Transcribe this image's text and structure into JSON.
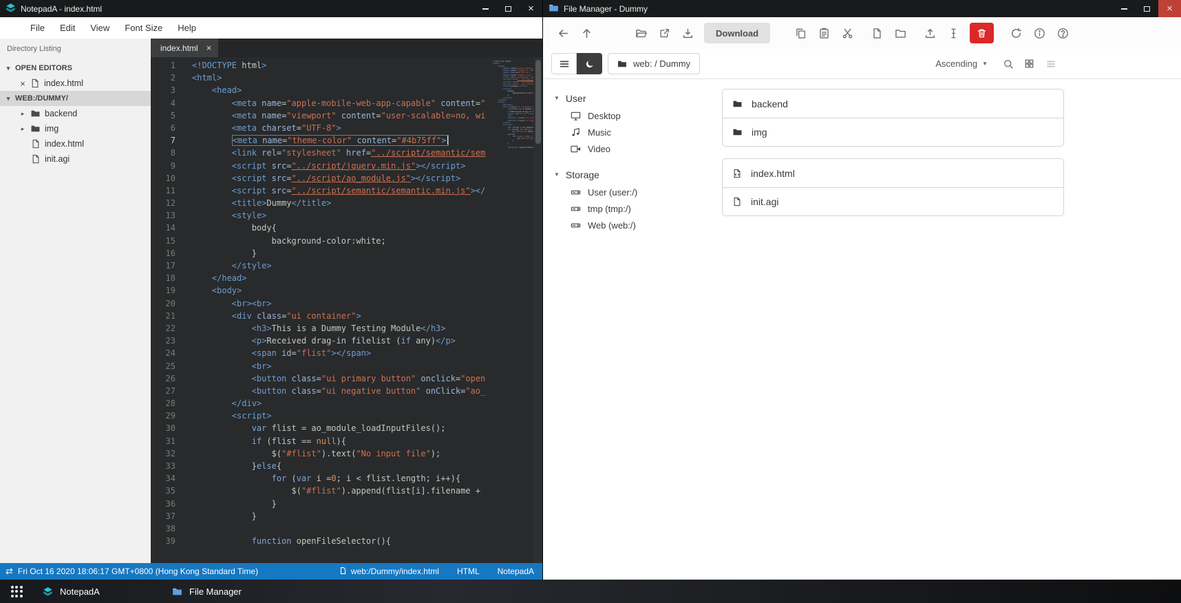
{
  "notepad": {
    "window_title": "NotepadA - index.html",
    "menu": [
      "File",
      "Edit",
      "View",
      "Font Size",
      "Help"
    ],
    "sidebar": {
      "header": "Directory Listing",
      "rows": [
        {
          "type": "section-open",
          "label": "OPEN EDITORS"
        },
        {
          "type": "open-editor",
          "label": "index.html"
        },
        {
          "type": "section-selected",
          "label": "WEB:/DUMMY/"
        },
        {
          "type": "folder",
          "label": "backend"
        },
        {
          "type": "folder",
          "label": "img"
        },
        {
          "type": "file",
          "label": "index.html"
        },
        {
          "type": "file",
          "label": "init.agi"
        }
      ]
    },
    "tab": {
      "label": "index.html",
      "close": "×"
    },
    "editor": {
      "active_line": 7,
      "lines": [
        "<!DOCTYPE html>",
        "<html>",
        "    <head>",
        "        <meta name=\"apple-mobile-web-app-capable\" content=\"yes\">",
        "        <meta name=\"viewport\" content=\"user-scalable=no, width=device-width\">",
        "        <meta charset=\"UTF-8\">",
        "        <meta name=\"theme-color\" content=\"#4b75ff\">",
        "        <link rel=\"stylesheet\" href=\"../script/semantic/semantic.min.css\">",
        "        <script src=\"../script/jquery.min.js\"></script>",
        "        <script src=\"../script/ao_module.js\"></script>",
        "        <script src=\"../script/semantic/semantic.min.js\"></script>",
        "        <title>Dummy</title>",
        "        <style>",
        "            body{",
        "                background-color:white;",
        "            }",
        "        </style>",
        "    </head>",
        "    <body>",
        "        <br><br>",
        "        <div class=\"ui container\">",
        "            <h3>This is a Dummy Testing Module</h3>",
        "            <p>Received drag-in filelist (if any)</p>",
        "            <span id=\"flist\"></span>",
        "            <br>",
        "            <button class=\"ui primary button\" onclick=\"openFileSelector()\">Open</button>",
        "            <button class=\"ui negative button\" onClick=\"ao_module_close()\">Close</button>",
        "        </div>",
        "        <script>",
        "            var flist = ao_module_loadInputFiles();",
        "            if (flist == null){",
        "                $(\"#flist\").text(\"No input file\");",
        "            }else{",
        "                for (var i =0; i < flist.length; i++){",
        "                    $(\"#flist\").append(flist[i].filename + \"<br>\");",
        "                }",
        "            }",
        "",
        "            function openFileSelector(){"
      ]
    },
    "statusbar": {
      "datetime": "Fri Oct 16 2020 18:06:17 GMT+0800 (Hong Kong Standard Time)",
      "file_path": "web:/Dummy/index.html",
      "syntax_mode": "HTML",
      "app_name": "NotepadA"
    }
  },
  "filemanager": {
    "window_title": "File Manager - Dummy",
    "toolbar": {
      "download_label": "Download"
    },
    "navbar": {
      "path": "web: / Dummy",
      "sort_order": "Ascending"
    },
    "sidebar": [
      {
        "label": "User",
        "items": [
          {
            "label": "Desktop",
            "icon": "desktop"
          },
          {
            "label": "Music",
            "icon": "music"
          },
          {
            "label": "Video",
            "icon": "video"
          }
        ]
      },
      {
        "label": "Storage",
        "items": [
          {
            "label": "User (user:/)",
            "icon": "drive"
          },
          {
            "label": "tmp (tmp:/)",
            "icon": "drive"
          },
          {
            "label": "Web (web:/)",
            "icon": "drive"
          }
        ]
      }
    ],
    "file_groups": [
      {
        "items": [
          {
            "name": "backend",
            "icon": "folder"
          },
          {
            "name": "img",
            "icon": "folder"
          }
        ]
      },
      {
        "items": [
          {
            "name": "index.html",
            "icon": "file-code"
          },
          {
            "name": "init.agi",
            "icon": "file"
          }
        ]
      }
    ]
  },
  "taskbar": {
    "items": [
      {
        "label": "NotepadA",
        "icon": "notepada"
      },
      {
        "label": "File Manager",
        "icon": "filemanager"
      }
    ]
  }
}
